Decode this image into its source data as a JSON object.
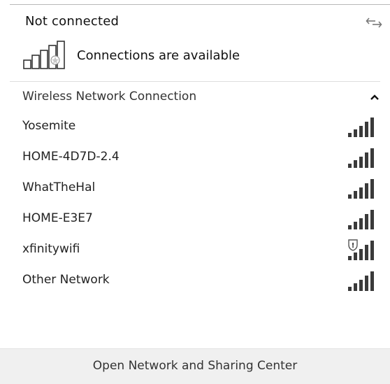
{
  "status": {
    "title": "Not connected",
    "availability_text": "Connections are available",
    "refresh_icon": "refresh-arrows-icon",
    "availability_icon": "signal-bars-star-icon"
  },
  "section": {
    "label": "Wireless Network Connection",
    "caret_icon": "chevron-up-icon"
  },
  "networks": [
    {
      "name": "Yosemite",
      "secured": true,
      "signal_icon": "wifi-signal-icon"
    },
    {
      "name": "HOME-4D7D-2.4",
      "secured": true,
      "signal_icon": "wifi-signal-icon"
    },
    {
      "name": "WhatTheHal",
      "secured": true,
      "signal_icon": "wifi-signal-icon"
    },
    {
      "name": "HOME-E3E7",
      "secured": true,
      "signal_icon": "wifi-signal-icon"
    },
    {
      "name": "xfinitywifi",
      "secured": false,
      "signal_icon": "wifi-signal-open-shield-icon"
    },
    {
      "name": "Other Network",
      "secured": true,
      "signal_icon": "wifi-signal-icon"
    }
  ],
  "footer": {
    "link_label": "Open Network and Sharing Center"
  },
  "colors": {
    "text": "#111111",
    "footer_bg": "#f0f0f0",
    "bar_dark": "#3a3a3a"
  }
}
